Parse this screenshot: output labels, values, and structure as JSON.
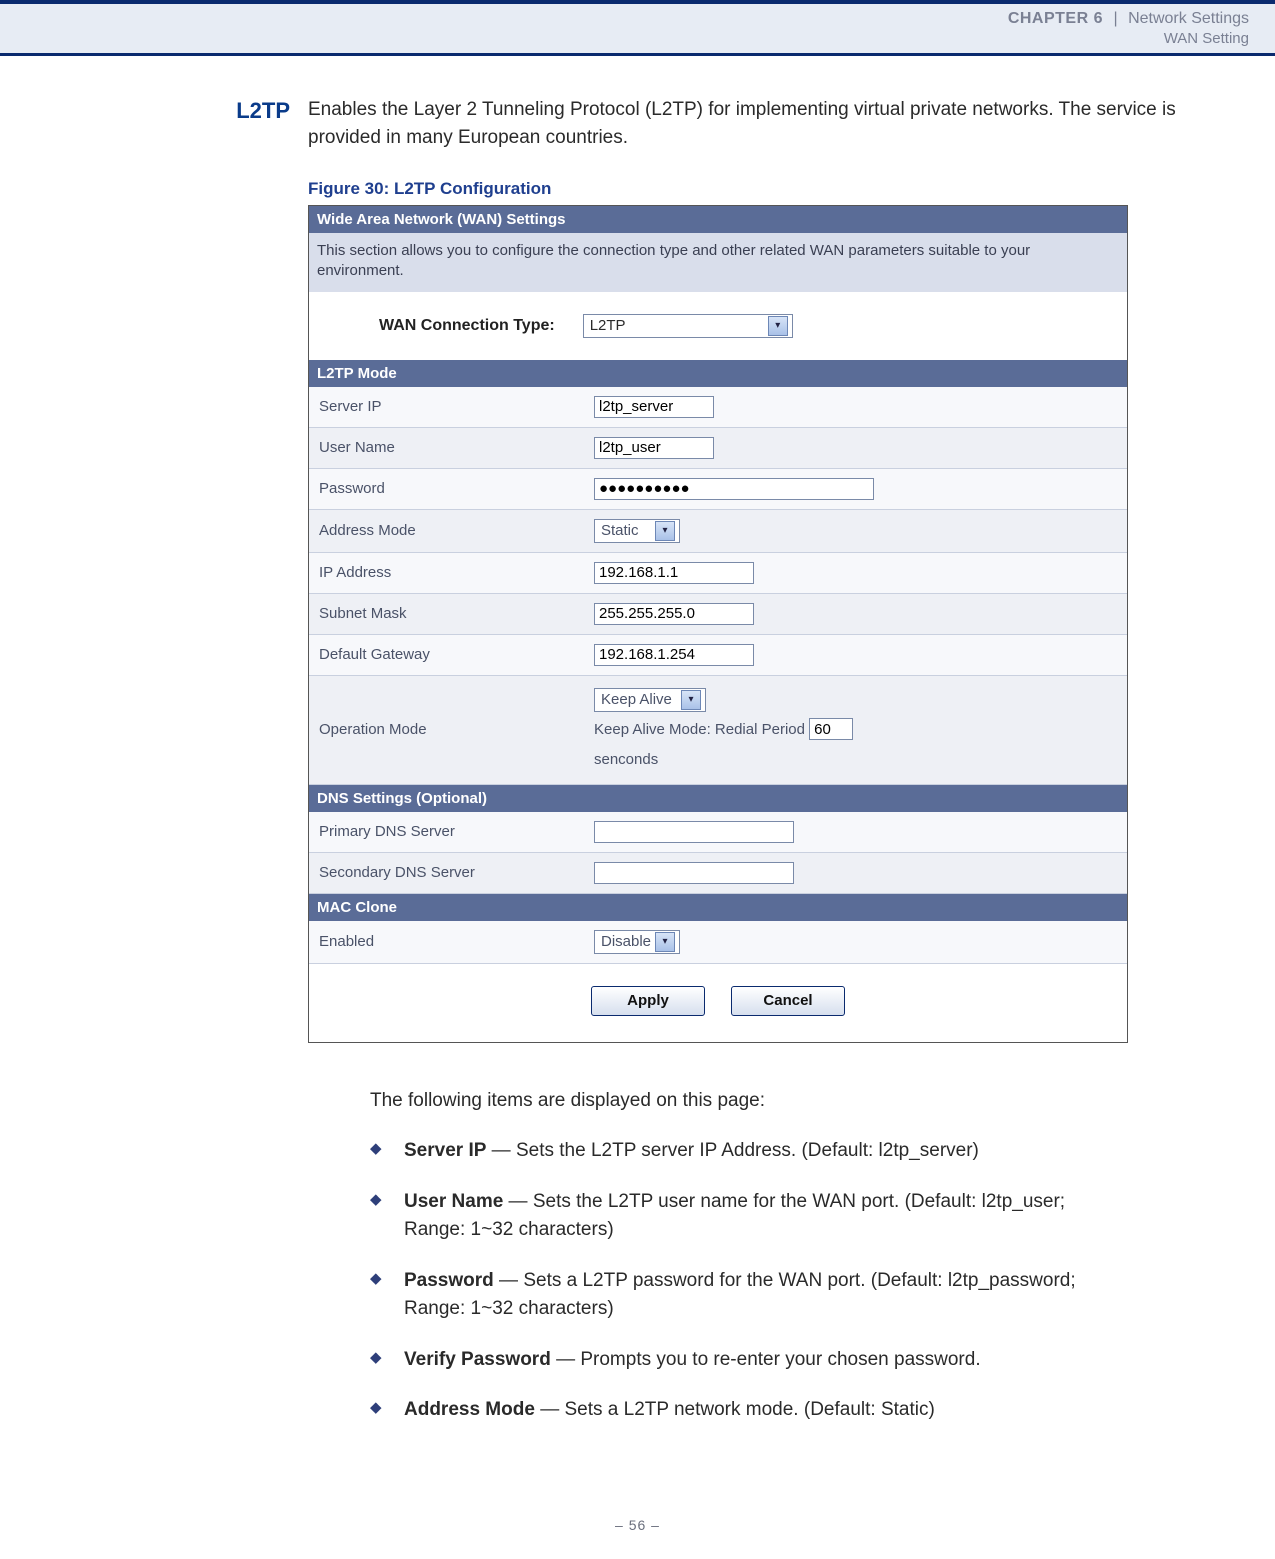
{
  "header": {
    "chapter_label": "CHAPTER 6",
    "separator": "|",
    "section": "Network Settings",
    "subsection": "WAN Setting"
  },
  "section_title": "L2TP",
  "lead_text": "Enables the Layer 2 Tunneling Protocol (L2TP) for implementing virtual private networks. The service is provided in many European countries.",
  "figure_caption": "Figure 30:  L2TP Configuration",
  "screenshot": {
    "wan_settings_header": "Wide Area Network (WAN) Settings",
    "wan_settings_desc": "This section allows you to configure the connection type and other related WAN parameters suitable to your environment.",
    "conn_type_label": "WAN Connection Type:",
    "conn_type_value": "L2TP",
    "section_l2tp": "L2TP Mode",
    "rows": {
      "server_ip": {
        "label": "Server IP",
        "value": "l2tp_server"
      },
      "user_name": {
        "label": "User Name",
        "value": "l2tp_user"
      },
      "password": {
        "label": "Password",
        "value": "●●●●●●●●●●"
      },
      "address_mode": {
        "label": "Address Mode",
        "value": "Static"
      },
      "ip_address": {
        "label": "IP Address",
        "value": "192.168.1.1"
      },
      "subnet_mask": {
        "label": "Subnet Mask",
        "value": "255.255.255.0"
      },
      "default_gateway": {
        "label": "Default Gateway",
        "value": "192.168.1.254"
      },
      "operation_mode": {
        "label": "Operation Mode",
        "select_value": "Keep Alive",
        "keep_alive_prefix": "Keep Alive Mode: Redial Period",
        "keep_alive_value": "60",
        "keep_alive_suffix": "senconds"
      }
    },
    "section_dns": "DNS Settings (Optional)",
    "dns_rows": {
      "primary": {
        "label": "Primary DNS Server",
        "value": ""
      },
      "secondary": {
        "label": "Secondary DNS Server",
        "value": ""
      }
    },
    "section_mac": "MAC Clone",
    "mac_row": {
      "label": "Enabled",
      "value": "Disable"
    },
    "buttons": {
      "apply": "Apply",
      "cancel": "Cancel"
    }
  },
  "after_figure_intro": "The following items are displayed on this page:",
  "bullets": [
    {
      "term": "Server IP",
      "desc": " — Sets the L2TP server IP Address. (Default: l2tp_server)"
    },
    {
      "term": "User Name",
      "desc": " — Sets the L2TP user name for the WAN port. (Default: l2tp_user; Range: 1~32 characters)"
    },
    {
      "term": "Password",
      "desc": " — Sets a L2TP password for the WAN port. (Default: l2tp_password; Range: 1~32 characters)"
    },
    {
      "term": "Verify Password",
      "desc": " — Prompts you to re-enter your chosen password."
    },
    {
      "term": "Address Mode",
      "desc": " — Sets a L2TP network mode. (Default: Static)"
    }
  ],
  "page_number": "–  56  –"
}
